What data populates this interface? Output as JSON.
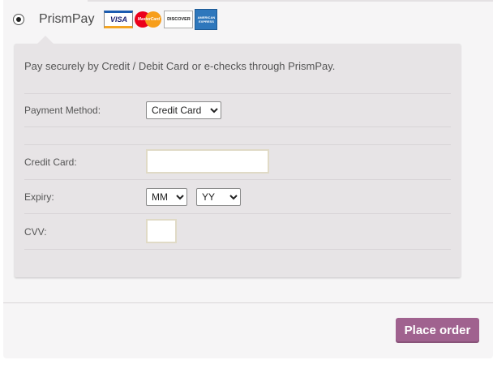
{
  "payment_method": {
    "title": "PrismPay",
    "selected": true,
    "logos": {
      "visa": "VISA",
      "mastercard": "MasterCard",
      "discover": "DISCOVER",
      "amex": "AMERICAN EXPRESS"
    }
  },
  "panel": {
    "description": "Pay securely by Credit / Debit Card or e-checks through PrismPay.",
    "method_label": "Payment Method:",
    "method_value": "Credit Card",
    "card_label": "Credit Card:",
    "card_value": "",
    "expiry_label": "Expiry:",
    "expiry_month": "MM",
    "expiry_year": "YY",
    "cvv_label": "CVV:",
    "cvv_value": ""
  },
  "actions": {
    "place_order": "Place order"
  },
  "colors": {
    "button": "#a0628f",
    "panel": "#e7e4e6",
    "background": "#f6f5f6"
  }
}
